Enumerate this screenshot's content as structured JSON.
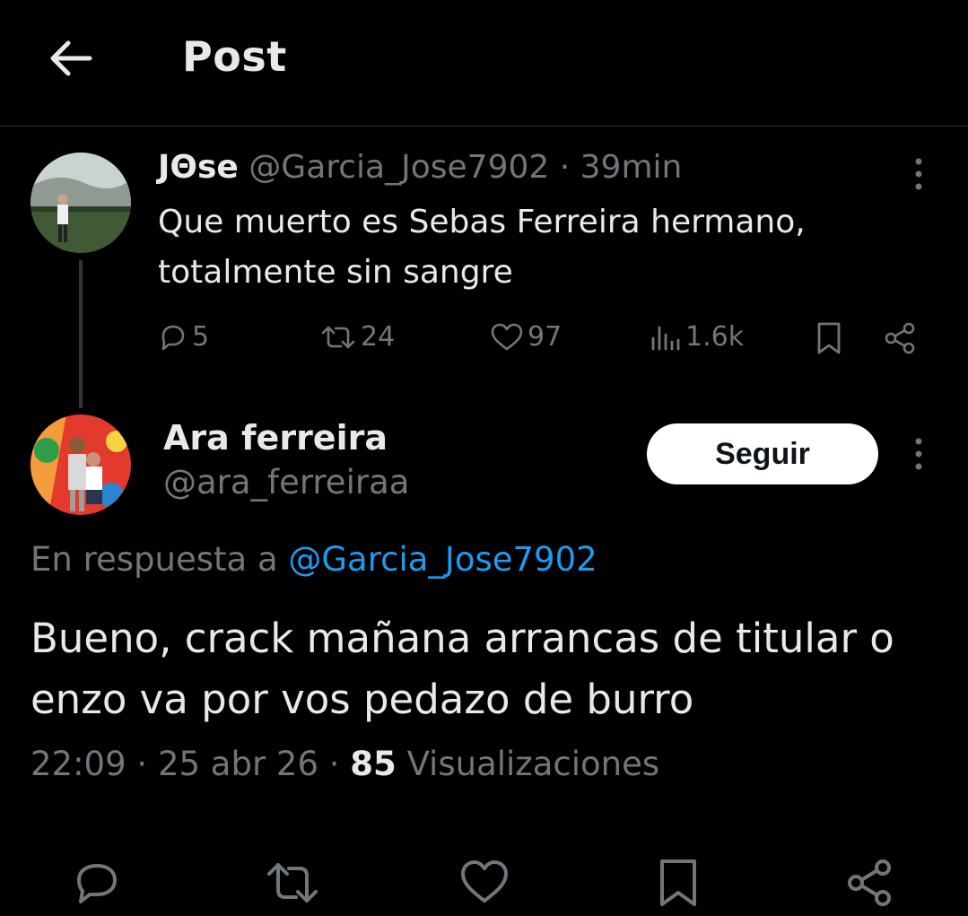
{
  "header": {
    "title": "Post",
    "back_icon": "arrow-left-icon"
  },
  "parent_tweet": {
    "display_name": "JΘse",
    "handle": "@Garcia_Jose7902",
    "separator": "·",
    "time_ago": "39min",
    "text": "Que muerto es Sebas Ferreira hermano, totalmente sin sangre",
    "stats": {
      "replies": "5",
      "reposts": "24",
      "likes": "97",
      "views": "1.6k"
    }
  },
  "reply_tweet": {
    "display_name": "Ara ferreira",
    "handle": "@ara_ferreiraa",
    "follow_label": "Seguir",
    "reply_prefix": "En respuesta a",
    "reply_to_handle": "@Garcia_Jose7902",
    "text": "Bueno, crack mañana arrancas de titular o enzo va por vos pedazo de burro",
    "time": "22:09",
    "sep1": "·",
    "date": "25 abr 26",
    "sep2": "·",
    "views_count": "85",
    "views_label": "Visualizaciones"
  },
  "colors": {
    "background": "#000000",
    "text": "#e7e9ea",
    "muted": "#71767b",
    "link": "#1d9bf0",
    "follow_button_bg": "#ffffff"
  },
  "bottom_bar": {
    "icons": [
      "reply-icon",
      "repost-icon",
      "like-icon",
      "bookmark-icon",
      "share-icon"
    ]
  }
}
